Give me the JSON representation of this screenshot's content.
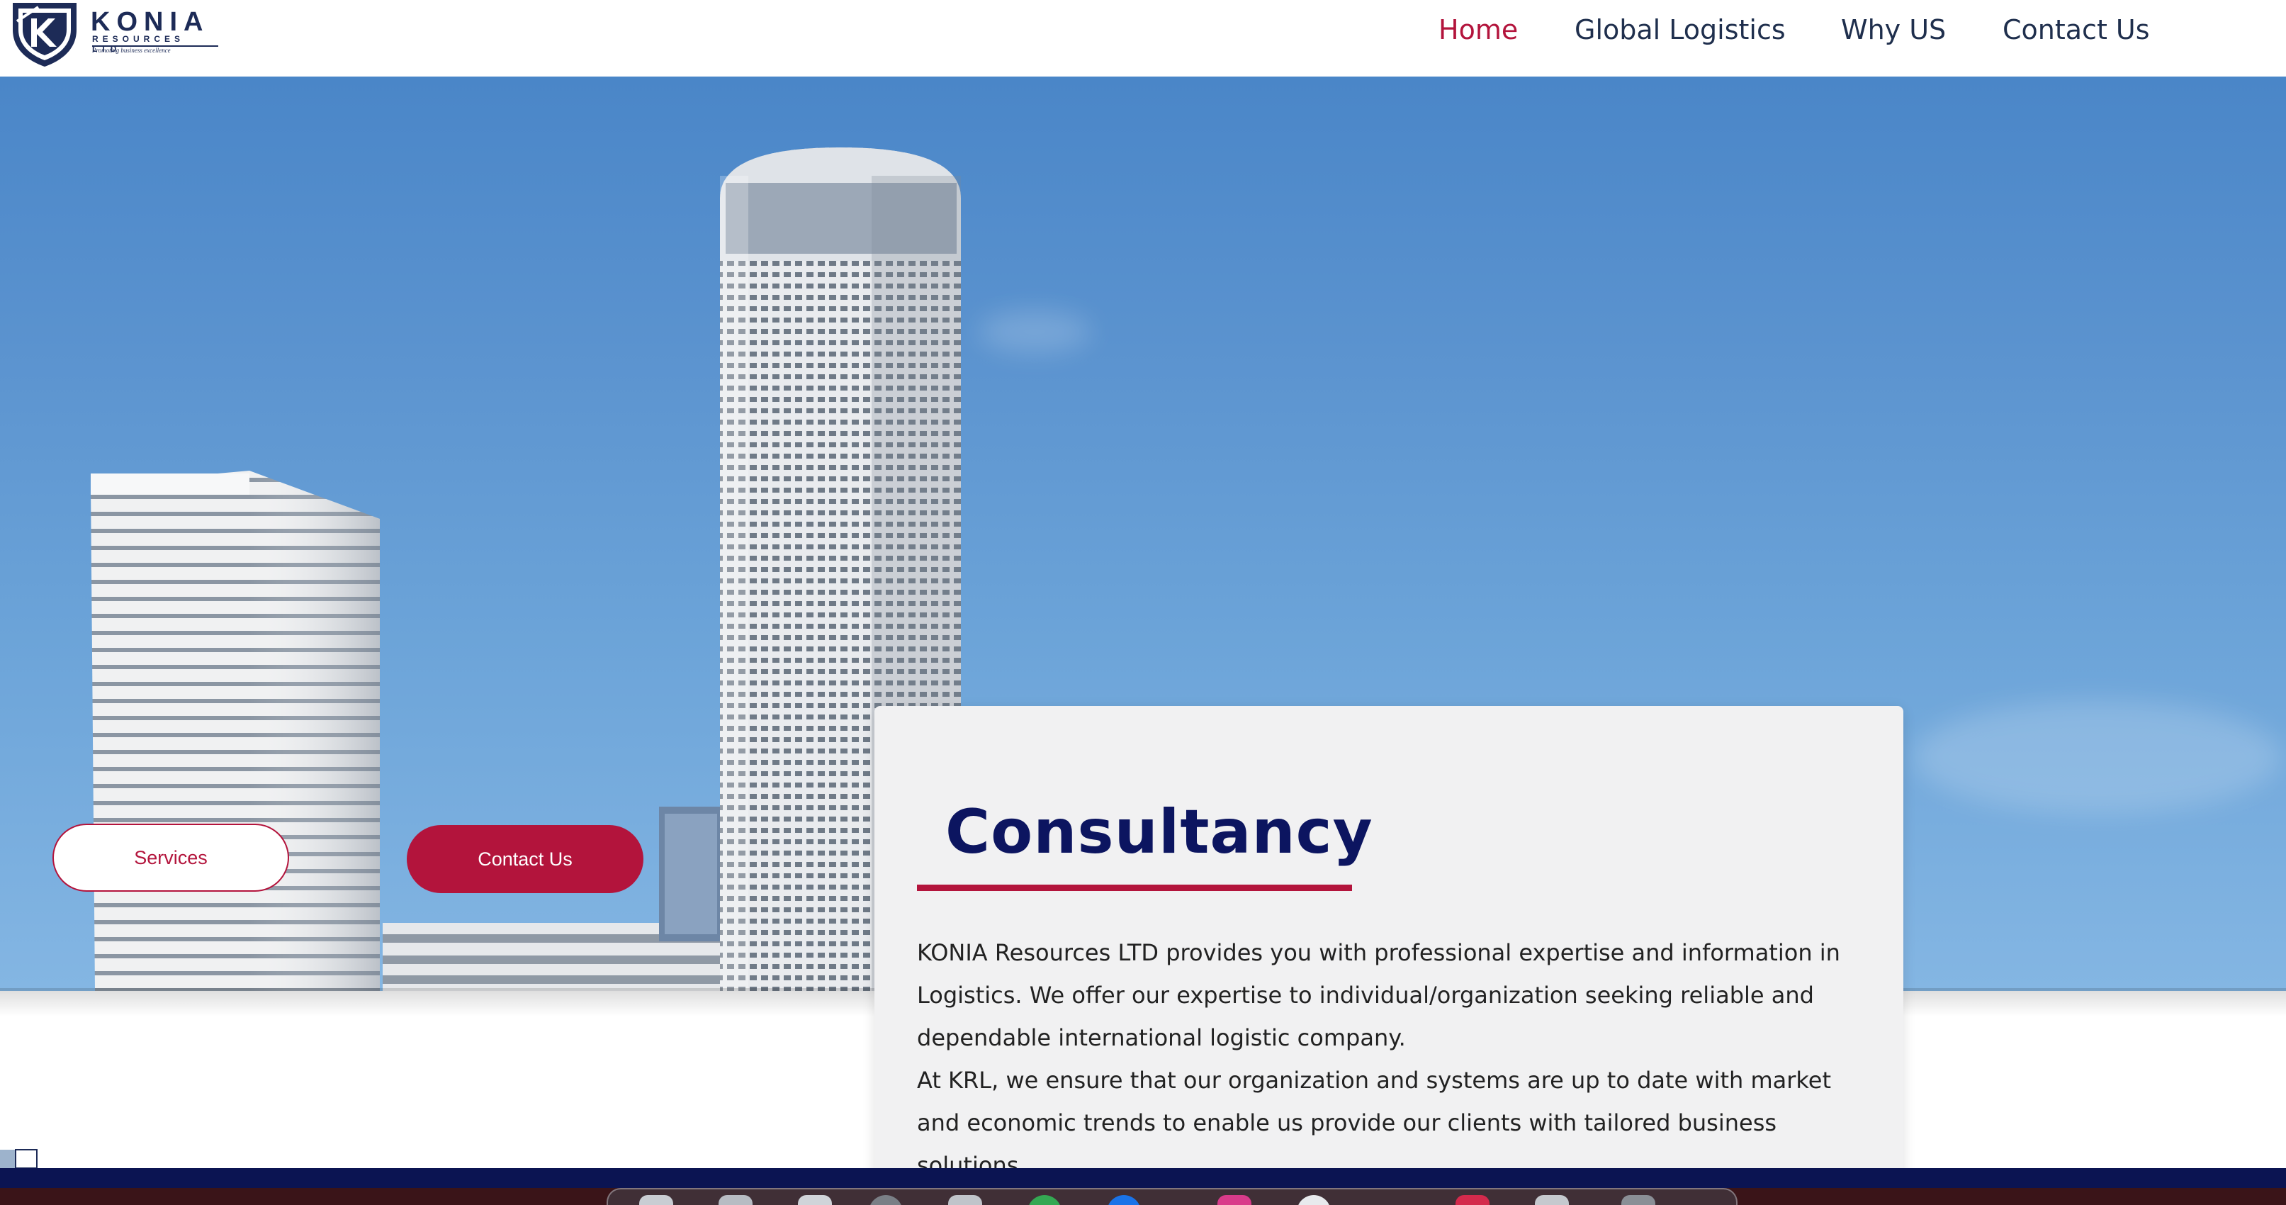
{
  "brand": {
    "name": "KONIA",
    "sub": "RESOURCES LTD",
    "tagline": "Promoting business excellence",
    "colors": {
      "navy": "#1d2b57",
      "crimson": "#b3143c",
      "title_navy": "#0c1560"
    }
  },
  "nav": {
    "items": [
      {
        "label": "Home",
        "active": true
      },
      {
        "label": "Global Logistics",
        "active": false
      },
      {
        "label": "Why US",
        "active": false
      },
      {
        "label": "Contact Us",
        "active": false
      }
    ]
  },
  "hero": {
    "buttons": {
      "services": "Services",
      "contact": "Contact Us"
    }
  },
  "card": {
    "title": "Consultancy",
    "paragraph1": "KONIA Resources LTD provides you with professional expertise and information in Logistics. We offer our expertise to individual/organization seeking reliable and dependable international logistic company.",
    "paragraph2": "At KRL, we ensure that our organization and systems are up to date with market and economic trends to enable us provide our clients with tailored business solutions."
  },
  "icons": [
    "shield-logo-icon",
    "dock-app-icon"
  ]
}
